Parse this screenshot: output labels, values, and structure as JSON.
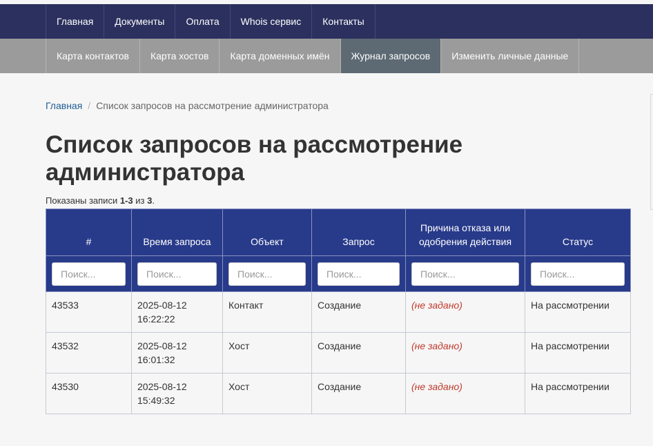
{
  "nav": {
    "top": [
      "Главная",
      "Документы",
      "Оплата",
      "Whois сервис",
      "Контакты"
    ],
    "sub": [
      "Карта контактов",
      "Карта хостов",
      "Карта доменных имён",
      "Журнал запросов",
      "Изменить личные данные"
    ]
  },
  "breadcrumb": {
    "home": "Главная",
    "separator": "/",
    "current": "Список запросов на рассмотрение администратора"
  },
  "page": {
    "title": "Список запросов на рассмотрение администратора",
    "summary_prefix": "Показаны записи ",
    "summary_range": "1-3",
    "summary_mid": " из ",
    "summary_total": "3",
    "summary_end": "."
  },
  "table": {
    "columns": [
      "#",
      "Время запроса",
      "Объект",
      "Запрос",
      "Причина отказа или одобрения действия",
      "Статус"
    ],
    "filter_placeholder": "Поиск...",
    "rows": [
      {
        "id": "43533",
        "date": "2025-08-12",
        "time": "16:22:22",
        "object": "Контакт",
        "request": "Создание",
        "reason": "(не задано)",
        "status": "На рассмотрении"
      },
      {
        "id": "43532",
        "date": "2025-08-12",
        "time": "16:01:32",
        "object": "Хост",
        "request": "Создание",
        "reason": "(не задано)",
        "status": "На рассмотрении"
      },
      {
        "id": "43530",
        "date": "2025-08-12",
        "time": "15:49:32",
        "object": "Хост",
        "request": "Создание",
        "reason": "(не задано)",
        "status": "На рассмотрении"
      }
    ]
  },
  "colors": {
    "top_nav_bg": "#2b305e",
    "sub_nav_bg": "#9b9b9b",
    "sub_nav_active_bg": "#5d6a73",
    "table_header_bg": "#283a8a",
    "link": "#1f5d96",
    "not_set": "#c0392b"
  }
}
